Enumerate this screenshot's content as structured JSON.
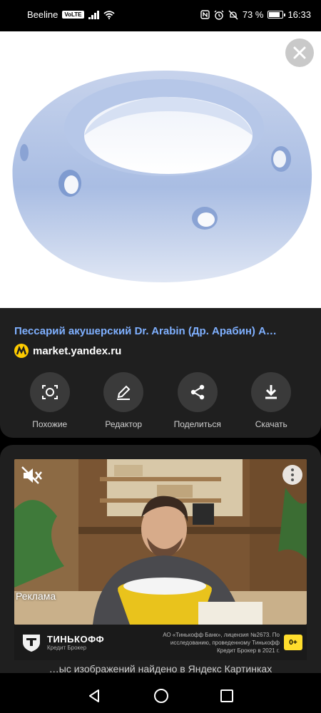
{
  "status_bar": {
    "carrier": "Beeline",
    "volte": "VoLTE",
    "battery": "73 %",
    "battery_level": 0.73,
    "time": "16:33",
    "icons": [
      "signal-icon",
      "wifi-icon",
      "nfc-icon",
      "alarm-icon",
      "mute-icon",
      "battery-icon"
    ]
  },
  "image_viewer": {
    "close_icon": "close-icon"
  },
  "result": {
    "title": "Пессарий акушерский Dr. Arabin (Др. Арабин) А…",
    "source": "market.yandex.ru",
    "source_icon": "market-icon"
  },
  "actions": [
    {
      "label": "Похожие",
      "icon": "lens-icon"
    },
    {
      "label": "Редактор",
      "icon": "pencil-icon"
    },
    {
      "label": "Поделиться",
      "icon": "share-icon"
    },
    {
      "label": "Скачать",
      "icon": "download-icon"
    }
  ],
  "ad": {
    "label": "Реклама",
    "brand": "ТИНЬКОФФ",
    "brand_sub": "Кредит Брокер",
    "legal": "АО «Тинькофф Банк», лицензия №2673. По исследованию, проведенному Тинькофф Кредит Брокер в 2021 г.",
    "age_rating": "0+",
    "colors": {
      "brand_yellow": "#ffdd2d"
    }
  },
  "footer": {
    "count_text": "…ыс изображений найдено в Яндекс Картинках"
  },
  "nav": {
    "icons": [
      "back-icon",
      "home-icon",
      "recents-icon"
    ]
  },
  "colors": {
    "link": "#7fb0ff",
    "sheet_bg": "#1f1f1f",
    "button_bg": "#3a3a3a"
  }
}
